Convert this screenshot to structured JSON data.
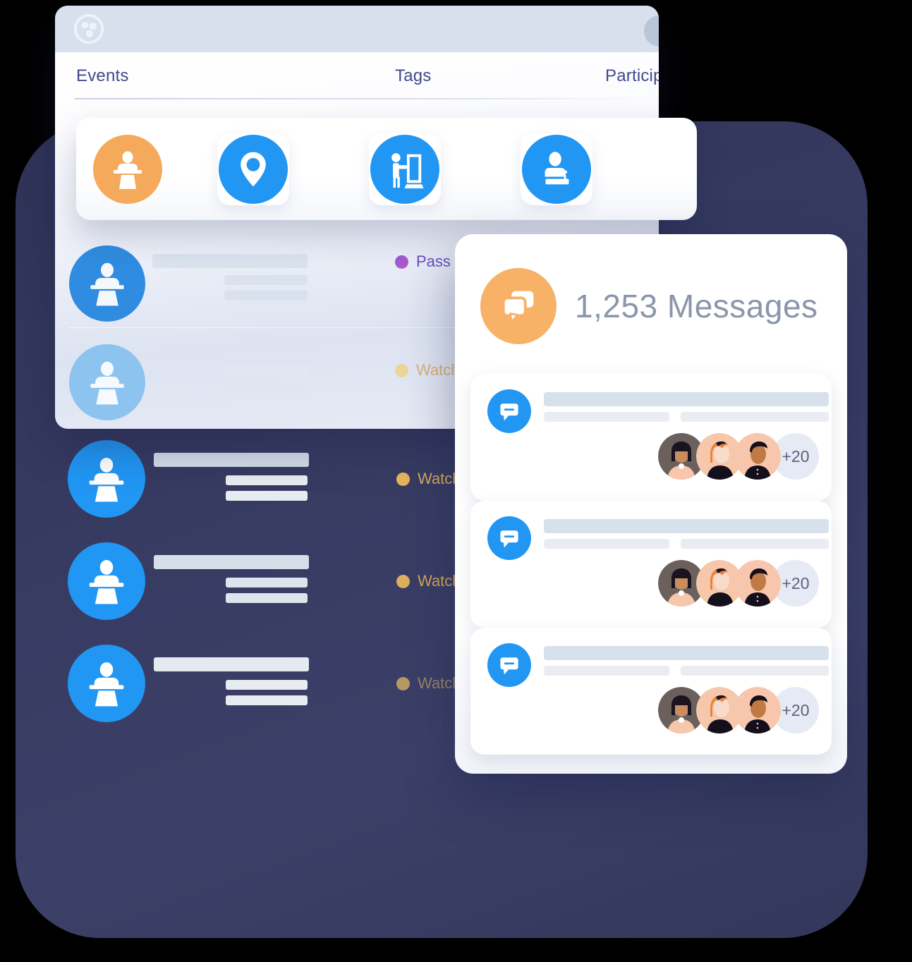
{
  "window": {
    "logo_icon": "community-logo-icon",
    "account_avatar_icon": "avatar-placeholder",
    "tabs": [
      {
        "label": "Events",
        "icon": "tab-events"
      },
      {
        "label": "Tags",
        "icon": "tab-tags"
      },
      {
        "label": "Participants",
        "icon": "tab-participants"
      }
    ]
  },
  "categories": [
    {
      "name": "speaker-podium",
      "icon": "speaker-podium-icon",
      "color": "#f5a95b"
    },
    {
      "name": "location-pin",
      "icon": "map-pin-icon",
      "color": "#2196f3"
    },
    {
      "name": "presentation",
      "icon": "presenter-board-icon",
      "color": "#2196f3"
    },
    {
      "name": "lecturer",
      "icon": "lecturer-desk-icon",
      "color": "#2196f3"
    }
  ],
  "event_rows": [
    {
      "icon": "speaker-podium-icon",
      "status": "Pass",
      "status_color": "#7b58c8",
      "dot_color": "#9b5fd0"
    },
    {
      "icon": "speaker-podium-icon",
      "status": "Watch",
      "status_color": "#d9b26a",
      "dot_color": "#efd28d"
    },
    {
      "icon": "speaker-podium-icon",
      "status": "Watch",
      "status_color": "#dcae5c",
      "dot_color": "#e8b65e"
    },
    {
      "icon": "speaker-podium-icon",
      "status": "Watch",
      "status_color": "#d3a759",
      "dot_color": "#dcae60"
    },
    {
      "icon": "speaker-podium-icon",
      "status": "Watch",
      "status_color": "#9a8460",
      "dot_color": "#b79a63"
    }
  ],
  "messages": {
    "header_icon": "chat-bubbles-icon",
    "header_title": "1,253 Messages",
    "items": [
      {
        "icon": "chat-bubble-icon",
        "overflow_count": "+20",
        "avatars": [
          {
            "name": "avatar-woman-dark-bob",
            "bg": "#6b605c",
            "skin": "#c98d5f",
            "hair": "#1a1320",
            "top": "#f7c6ad"
          },
          {
            "name": "avatar-person-ginger",
            "bg": "#f6c7ab",
            "skin": "#f7dcc9",
            "hair": "#e8833d",
            "top": "#130f1c"
          },
          {
            "name": "avatar-man-dark-hair",
            "bg": "#f7c6ad",
            "skin": "#c07b45",
            "hair": "#140f1b",
            "top": "#130f1c"
          }
        ]
      },
      {
        "icon": "chat-bubble-icon",
        "overflow_count": "+20",
        "avatars": [
          {
            "name": "avatar-woman-dark-bob",
            "bg": "#6b605c",
            "skin": "#c98d5f",
            "hair": "#1a1320",
            "top": "#f7c6ad"
          },
          {
            "name": "avatar-person-ginger",
            "bg": "#f6c7ab",
            "skin": "#f7dcc9",
            "hair": "#e8833d",
            "top": "#130f1c"
          },
          {
            "name": "avatar-man-dark-hair",
            "bg": "#f7c6ad",
            "skin": "#c07b45",
            "hair": "#140f1b",
            "top": "#130f1c"
          }
        ]
      },
      {
        "icon": "chat-bubble-icon",
        "overflow_count": "+20",
        "avatars": [
          {
            "name": "avatar-woman-dark-bob",
            "bg": "#6b605c",
            "skin": "#c98d5f",
            "hair": "#1a1320",
            "top": "#f7c6ad"
          },
          {
            "name": "avatar-person-ginger",
            "bg": "#f6c7ab",
            "skin": "#f7dcc9",
            "hair": "#e8833d",
            "top": "#130f1c"
          },
          {
            "name": "avatar-man-dark-hair",
            "bg": "#f7c6ad",
            "skin": "#c07b45",
            "hair": "#140f1b",
            "top": "#130f1c"
          }
        ]
      }
    ]
  },
  "theme": {
    "accent_blue": "#2196f3",
    "accent_orange": "#f5a95b",
    "backdrop_navy": "#383c63",
    "topbar": "#d7e0ec",
    "tab_text": "#3f4a8c"
  }
}
